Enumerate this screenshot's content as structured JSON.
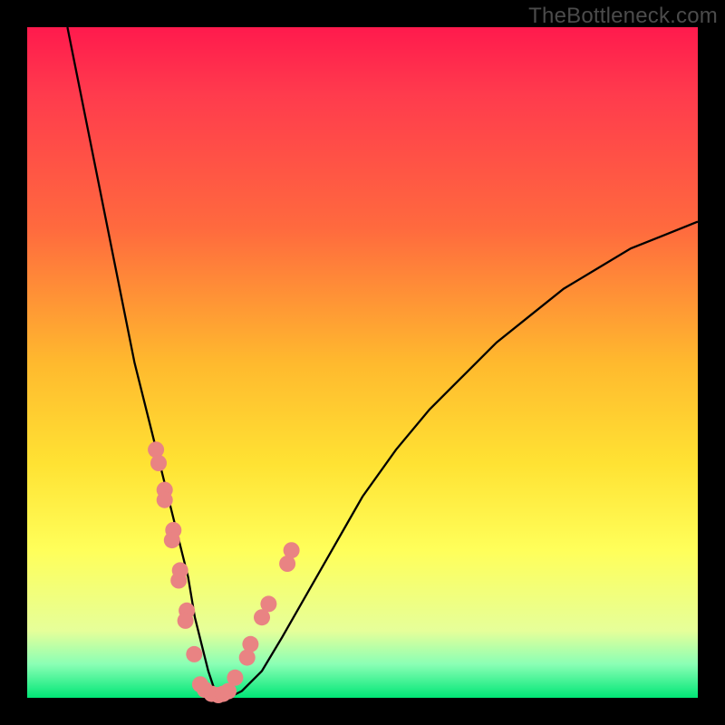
{
  "watermark": "TheBottleneck.com",
  "chart_data": {
    "type": "line",
    "title": "",
    "xlabel": "",
    "ylabel": "",
    "xlim": [
      0,
      100
    ],
    "ylim": [
      0,
      100
    ],
    "curve": {
      "name": "bottleneck-curve",
      "x": [
        6,
        8,
        10,
        12,
        14,
        16,
        18,
        20,
        22,
        24,
        25,
        26,
        27,
        28,
        30,
        32,
        35,
        38,
        42,
        46,
        50,
        55,
        60,
        65,
        70,
        75,
        80,
        85,
        90,
        95,
        100
      ],
      "y": [
        100,
        90,
        80,
        70,
        60,
        50,
        42,
        34,
        26,
        18,
        12,
        8,
        4,
        1,
        0,
        1,
        4,
        9,
        16,
        23,
        30,
        37,
        43,
        48,
        53,
        57,
        61,
        64,
        67,
        69,
        71
      ]
    },
    "dots_left": {
      "name": "left-cluster",
      "x": [
        19.2,
        19.6,
        20.5,
        20.5,
        21.8,
        21.6,
        22.8,
        22.6,
        23.8,
        23.6,
        24.9
      ],
      "y": [
        37.0,
        35.0,
        31.0,
        29.5,
        25.0,
        23.5,
        19.0,
        17.5,
        13.0,
        11.5,
        6.5
      ]
    },
    "dots_right": {
      "name": "right-cluster",
      "x": [
        31.0,
        32.8,
        33.3,
        35.0,
        36.0,
        38.8,
        39.4
      ],
      "y": [
        3.0,
        6.0,
        8.0,
        12.0,
        14.0,
        20.0,
        22.0
      ]
    },
    "dots_trough": {
      "name": "trough-cluster",
      "x": [
        25.8,
        26.5,
        27.5,
        28.5,
        29.2,
        30.0
      ],
      "y": [
        2.0,
        1.2,
        0.6,
        0.4,
        0.6,
        1.0
      ]
    },
    "gradient_stops": [
      {
        "pct": 0,
        "color": "#ff1a4d"
      },
      {
        "pct": 50,
        "color": "#ffb92e"
      },
      {
        "pct": 78,
        "color": "#ffff5a"
      },
      {
        "pct": 100,
        "color": "#00e676"
      }
    ]
  }
}
